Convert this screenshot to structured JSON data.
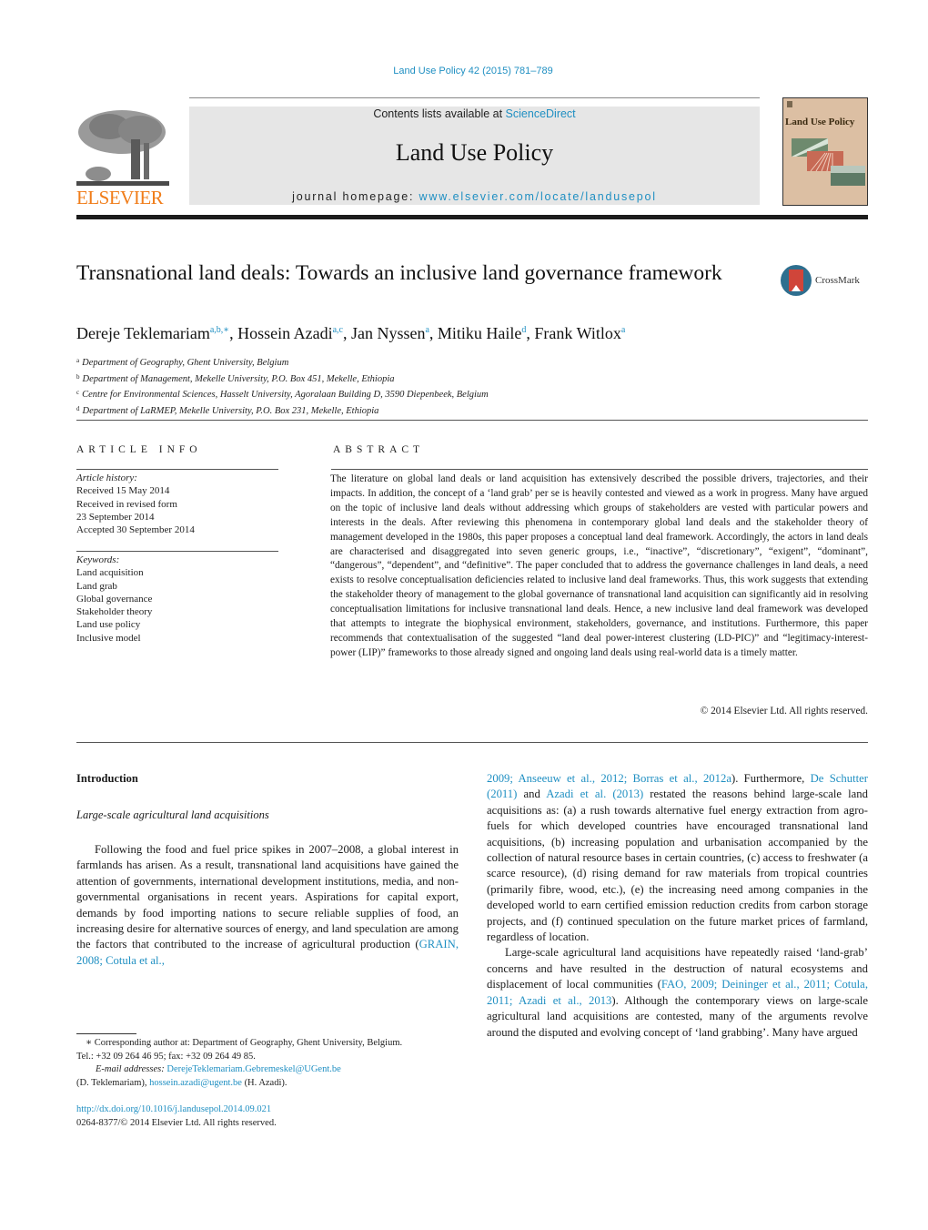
{
  "header": {
    "citation": "Land Use Policy 42 (2015) 781–789",
    "contents_prefix": "Contents lists available at ",
    "contents_link": "ScienceDirect",
    "journal_name": "Land Use Policy",
    "homepage_prefix": "journal homepage: ",
    "homepage_link": "www.elsevier.com/locate/landusepol",
    "publisher_logo": "ELSEVIER",
    "cover_title": "Land Use Policy",
    "crossmark_label": "CrossMark",
    "brand_colors": {
      "link": "#1f8fc2",
      "elsevier": "#f07d1a"
    }
  },
  "article": {
    "title": "Transnational land deals: Towards an inclusive land governance framework",
    "authors": [
      {
        "name": "Dereje Teklemariam",
        "sup": "a,b,∗"
      },
      {
        "name": "Hossein Azadi",
        "sup": "a,c"
      },
      {
        "name": "Jan Nyssen",
        "sup": "a"
      },
      {
        "name": "Mitiku Haile",
        "sup": "d"
      },
      {
        "name": "Frank Witlox",
        "sup": "a"
      }
    ],
    "affiliations": [
      {
        "key": "a",
        "text": "Department of Geography, Ghent University, Belgium"
      },
      {
        "key": "b",
        "text": "Department of Management, Mekelle University, P.O. Box 451, Mekelle, Ethiopia"
      },
      {
        "key": "c",
        "text": "Centre for Environmental Sciences, Hasselt University, Agoralaan Building D, 3590 Diepenbeek, Belgium"
      },
      {
        "key": "d",
        "text": "Department of LaRMEP, Mekelle University, P.O. Box 231, Mekelle, Ethiopia"
      }
    ]
  },
  "article_info": {
    "heading": "ARTICLE INFO",
    "history_label": "Article history:",
    "history": [
      "Received 15 May 2014",
      "Received in revised form",
      "23 September 2014",
      "Accepted 30 September 2014"
    ],
    "keywords_label": "Keywords:",
    "keywords": [
      "Land acquisition",
      "Land grab",
      "Global governance",
      "Stakeholder theory",
      "Land use policy",
      "Inclusive model"
    ]
  },
  "abstract": {
    "heading": "ABSTRACT",
    "text": "The literature on global land deals or land acquisition has extensively described the possible drivers, trajectories, and their impacts. In addition, the concept of a ‘land grab’ per se is heavily contested and viewed as a work in progress. Many have argued on the topic of inclusive land deals without addressing which groups of stakeholders are vested with particular powers and interests in the deals. After reviewing this phenomena in contemporary global land deals and the stakeholder theory of management developed in the 1980s, this paper proposes a conceptual land deal framework. Accordingly, the actors in land deals are characterised and disaggregated into seven generic groups, i.e., “inactive”, “discretionary”, “exigent”, “dominant”, “dangerous”, “dependent”, and “definitive”. The paper concluded that to address the governance challenges in land deals, a need exists to resolve conceptualisation deficiencies related to inclusive land deal frameworks. Thus, this work suggests that extending the stakeholder theory of management to the global governance of transnational land acquisition can significantly aid in resolving conceptualisation limitations for inclusive transnational land deals. Hence, a new inclusive land deal framework was developed that attempts to integrate the biophysical environment, stakeholders, governance, and institutions. Furthermore, this paper recommends that contextualisation of the suggested “land deal power-interest clustering (LD-PIC)” and “legitimacy-interest-power (LIP)” frameworks to those already signed and ongoing land deals using real-world data is a timely matter.",
    "copyright": "© 2014 Elsevier Ltd. All rights reserved."
  },
  "body": {
    "section_heading": "Introduction",
    "subsection_heading": "Large-scale agricultural land acquisitions",
    "left_para_text": "Following the food and fuel price spikes in 2007–2008, a global interest in farmlands has arisen. As a result, transnational land acquisitions have gained the attention of governments, international development institutions, media, and non-governmental organisations in recent years. Aspirations for capital export, demands by food importing nations to secure reliable supplies of food, an increasing desire for alternative sources of energy, and land speculation are among the factors that contributed to the increase of agricultural production (",
    "left_para_cite": "GRAIN, 2008; Cotula et al.,",
    "right_p1_cite1": "2009; Anseeuw et al., 2012; Borras et al., 2012a",
    "right_p1_text1": "). Furthermore, ",
    "right_p1_cite2": "De Schutter (2011)",
    "right_p1_text2": " and ",
    "right_p1_cite3": "Azadi et al. (2013)",
    "right_p1_text3": " restated the reasons behind large-scale land acquisitions as: (a) a rush towards alternative fuel energy extraction from agro-fuels for which developed countries have encouraged transnational land acquisitions, (b) increasing population and urbanisation accompanied by the collection of natural resource bases in certain countries, (c) access to freshwater (a scarce resource), (d) rising demand for raw materials from tropical countries (primarily fibre, wood, etc.), (e) the increasing need among companies in the developed world to earn certified emission reduction credits from carbon storage projects, and (f) continued speculation on the future market prices of farmland, regardless of location.",
    "right_p2_text1": "Large-scale agricultural land acquisitions have repeatedly raised ‘land-grab’ concerns and have resulted in the destruction of natural ecosystems and displacement of local communities (",
    "right_p2_cite": "FAO, 2009; Deininger et al., 2011; Cotula, 2011; Azadi et al., 2013",
    "right_p2_text2": "). Although the contemporary views on large-scale agricultural land acquisitions are contested, many of the arguments revolve around the disputed and evolving concept of ‘land grabbing’. Many have argued"
  },
  "footnote": {
    "corresponding": "∗ Corresponding author at: Department of Geography, Ghent University, Belgium.",
    "phone": "Tel.: +32 09 264 46 95; fax: +32 09 264 49 85.",
    "email_label": "E-mail addresses: ",
    "email1": "DerejeTeklemariam.Gebremeskel@UGent.be",
    "email1_owner": "(D. Teklemariam), ",
    "email2": "hossein.azadi@ugent.be",
    "email2_owner": " (H. Azadi).",
    "doi": "http://dx.doi.org/10.1016/j.landusepol.2014.09.021",
    "issn": "0264-8377/© 2014 Elsevier Ltd. All rights reserved."
  }
}
